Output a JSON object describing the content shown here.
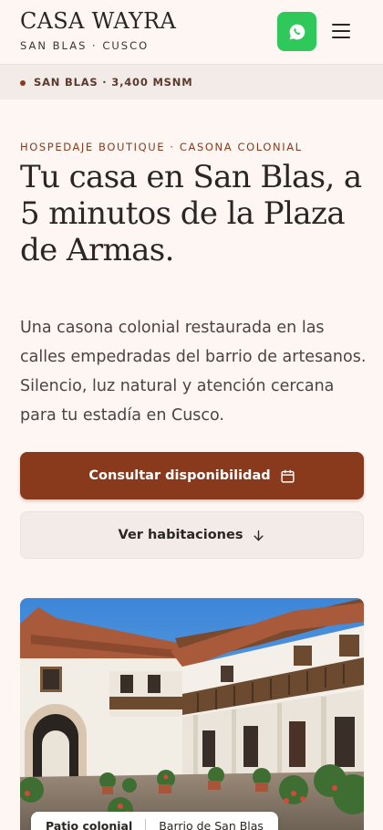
{
  "header": {
    "brand": "CASA WAYRA",
    "brand_sub": "SAN BLAS · CUSCO",
    "whatsapp_icon": "whatsapp-icon",
    "menu_icon": "menu-icon",
    "accent": "#2fc85a"
  },
  "location_bar": {
    "text": "SAN BLAS · 3,400 MSNM"
  },
  "hero": {
    "eyebrow": "HOSPEDAJE BOUTIQUE · CASONA COLONIAL",
    "headline": "Tu casa en San Blas, a 5 minutos de la Plaza de Armas.",
    "description": "Una casona colonial restaurada en las calles empedradas del barrio de artesanos. Silencio, luz natural y atención cercana para tu estadía en Cusco."
  },
  "actions": {
    "primary_label": "Consultar disponibilidad",
    "primary_icon": "calendar-icon",
    "secondary_label": "Ver habitaciones",
    "secondary_icon": "arrow-down-icon",
    "primary_color": "#8a3a1c"
  },
  "gallery": {
    "tabs": [
      "Patio colonial",
      "Barrio de San Blas"
    ],
    "active_tab": 0
  }
}
